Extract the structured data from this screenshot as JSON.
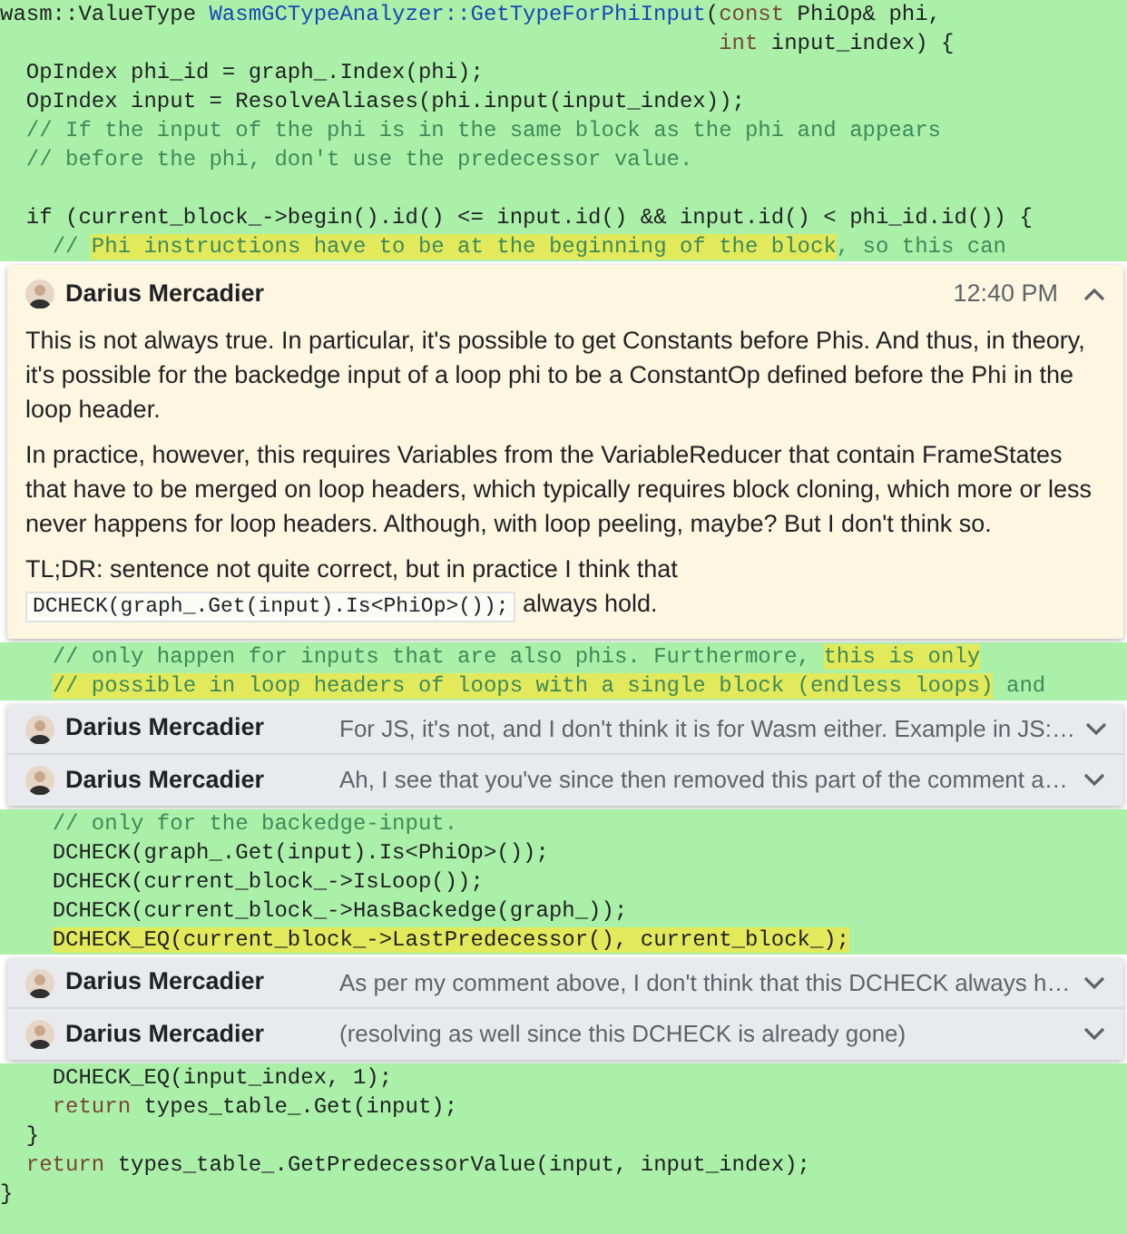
{
  "sections": [
    {
      "kind": "code",
      "lines": [
        {
          "kind": "code",
          "segments": [
            {
              "text": "wasm::ValueType ",
              "kind": "plain",
              "highlighted": false
            },
            {
              "text": "WasmGCTypeAnalyzer::GetTypeForPhiInput",
              "kind": "type",
              "highlighted": false
            },
            {
              "text": "(",
              "kind": "plain",
              "highlighted": false
            },
            {
              "text": "const",
              "kind": "keyword",
              "highlighted": false
            },
            {
              "text": " PhiOp& phi,",
              "kind": "plain",
              "highlighted": false
            }
          ]
        },
        {
          "kind": "code",
          "segments": [
            {
              "text": "                                                       int",
              "kind": "keyword",
              "highlighted": false
            },
            {
              "text": " input_index) {",
              "kind": "plain",
              "highlighted": false
            }
          ]
        },
        {
          "kind": "code",
          "segments": [
            {
              "text": "  OpIndex phi_id = graph_.Index(phi);",
              "kind": "plain",
              "highlighted": false
            }
          ]
        },
        {
          "kind": "code",
          "segments": [
            {
              "text": "  OpIndex input = ResolveAliases(phi.input(input_index));",
              "kind": "plain",
              "highlighted": false
            }
          ]
        },
        {
          "kind": "code",
          "segments": [
            {
              "text": "  // If the input of the phi is in the same block as the phi and appears",
              "kind": "comment",
              "highlighted": false
            }
          ]
        },
        {
          "kind": "code",
          "segments": [
            {
              "text": "  // before the phi, don't use the predecessor value.",
              "kind": "comment",
              "highlighted": false
            }
          ]
        },
        {
          "kind": "blank"
        },
        {
          "kind": "code",
          "segments": [
            {
              "text": "  if (current_block_->begin().id() <= input.id() && input.id() < phi_id.id()) {",
              "kind": "plain",
              "highlighted": false
            }
          ]
        },
        {
          "kind": "code",
          "segments": [
            {
              "text": "    // ",
              "kind": "comment",
              "highlighted": false
            },
            {
              "text": "Phi instructions have to be at the beginning of the block",
              "kind": "comment",
              "highlighted": true
            },
            {
              "text": ", so this can",
              "kind": "comment",
              "highlighted": false
            }
          ]
        }
      ]
    },
    {
      "kind": "thread",
      "comments": [
        {
          "author": "Darius Mercadier",
          "expanded": true,
          "time": "12:40 PM",
          "paragraphs": [
            {
              "parts": [
                {
                  "kind": "text",
                  "text": "This is not always true. In particular, it's possible to get Constants before Phis. And thus, in theory, it's possible for the backedge input of a loop phi to be a ConstantOp defined before the Phi in the loop header."
                }
              ]
            },
            {
              "parts": [
                {
                  "kind": "text",
                  "text": "In practice, however, this requires Variables from the VariableReducer that contain FrameStates that have to be merged on loop headers, which typically requires block cloning, which more or less never happens for loop headers. Although, with loop peeling, maybe? But I don't think so."
                }
              ]
            },
            {
              "parts": [
                {
                  "kind": "text",
                  "text": "TL;DR: sentence not quite correct, but in practice I think that "
                },
                {
                  "kind": "code",
                  "text": "DCHECK(graph_.Get(input).Is<PhiOp>());"
                },
                {
                  "kind": "text",
                  "text": " always hold."
                }
              ]
            }
          ]
        }
      ]
    },
    {
      "kind": "code",
      "lines": [
        {
          "kind": "code",
          "segments": [
            {
              "text": "    // only happen for inputs that are also phis. Furthermore, ",
              "kind": "comment",
              "highlighted": false
            },
            {
              "text": "this is only",
              "kind": "comment",
              "highlighted": true
            }
          ]
        },
        {
          "kind": "code",
          "segments": [
            {
              "text": "    // possible in loop headers of loops with a single block (endless loops)",
              "kind": "comment",
              "highlighted": true
            },
            {
              "text": " and",
              "kind": "comment",
              "highlighted": false
            }
          ]
        }
      ]
    },
    {
      "kind": "thread",
      "comments": [
        {
          "author": "Darius Mercadier",
          "expanded": false,
          "snippet": "For JS, it's not, and I don't think it is for Wasm either. Example in JS:…"
        },
        {
          "author": "Darius Mercadier",
          "expanded": false,
          "snippet": "Ah, I see that you've since then removed this part of the comment a…"
        }
      ]
    },
    {
      "kind": "code",
      "lines": [
        {
          "kind": "code",
          "segments": [
            {
              "text": "    // only for the backedge-input.",
              "kind": "comment",
              "highlighted": false
            }
          ]
        },
        {
          "kind": "code",
          "segments": [
            {
              "text": "    DCHECK(graph_.Get(input).Is<PhiOp>());",
              "kind": "plain",
              "highlighted": false
            }
          ]
        },
        {
          "kind": "code",
          "segments": [
            {
              "text": "    DCHECK(current_block_->IsLoop());",
              "kind": "plain",
              "highlighted": false
            }
          ]
        },
        {
          "kind": "code",
          "segments": [
            {
              "text": "    DCHECK(current_block_->HasBackedge(graph_));",
              "kind": "plain",
              "highlighted": false
            }
          ]
        },
        {
          "kind": "code",
          "segments": [
            {
              "text": "    DCHECK_EQ(current_block_->LastPredecessor(), current_block_);",
              "kind": "plain",
              "highlighted": true
            }
          ]
        }
      ]
    },
    {
      "kind": "thread",
      "comments": [
        {
          "author": "Darius Mercadier",
          "expanded": false,
          "snippet": "As per my comment above, I don't think that this DCHECK always h…"
        },
        {
          "author": "Darius Mercadier",
          "expanded": false,
          "snippet": "(resolving as well since this DCHECK is already gone)"
        }
      ]
    },
    {
      "kind": "code",
      "lines": [
        {
          "kind": "code",
          "segments": [
            {
              "text": "    DCHECK_EQ(input_index, 1);",
              "kind": "plain",
              "highlighted": false
            }
          ]
        },
        {
          "kind": "code",
          "segments": [
            {
              "text": "    return",
              "kind": "keyword",
              "highlighted": false
            },
            {
              "text": " types_table_.Get(input);",
              "kind": "plain",
              "highlighted": false
            }
          ]
        },
        {
          "kind": "code",
          "segments": [
            {
              "text": "  }",
              "kind": "plain",
              "highlighted": false
            }
          ]
        },
        {
          "kind": "code",
          "segments": [
            {
              "text": "  return",
              "kind": "keyword",
              "highlighted": false
            },
            {
              "text": " types_table_.GetPredecessorValue(input, input_index);",
              "kind": "plain",
              "highlighted": false
            }
          ]
        },
        {
          "kind": "code",
          "segments": [
            {
              "text": "}",
              "kind": "plain",
              "highlighted": false
            }
          ]
        }
      ]
    }
  ]
}
